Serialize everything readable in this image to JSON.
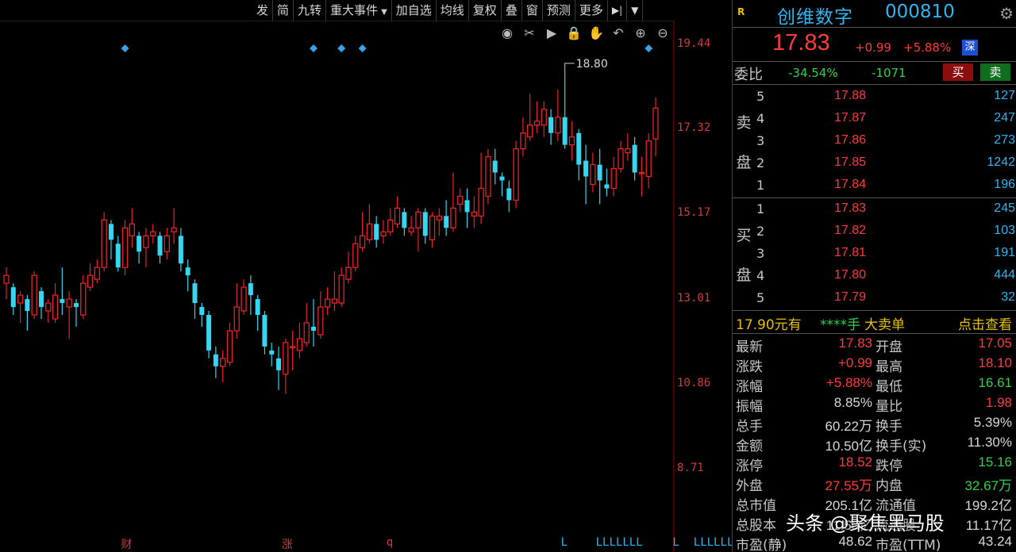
{
  "toolbar": {
    "items": [
      "发",
      "简",
      "九转",
      "重大事件",
      "加自选",
      "均线",
      "复权",
      "叠",
      "窗",
      "预测",
      "更多"
    ],
    "has_arrow": [
      false,
      false,
      false,
      true,
      false,
      false,
      false,
      false,
      false,
      false,
      false
    ]
  },
  "chart_tools": [
    "eye-icon",
    "scissors-icon",
    "play-icon",
    "lock-icon",
    "hand-icon",
    "undo-icon",
    "zoom-in-icon",
    "zoom-out-icon"
  ],
  "chart_data": {
    "type": "candlestick",
    "y_ticks": [
      "19.44",
      "17.32",
      "15.17",
      "13.01",
      "10.86",
      "8.71"
    ],
    "ylim": [
      8.71,
      19.44
    ],
    "peak_annotation": "18.80",
    "candles": [
      {
        "o": 13.4,
        "c": 13.6,
        "h": 13.8,
        "l": 13.0
      },
      {
        "o": 13.3,
        "c": 12.8,
        "h": 13.4,
        "l": 12.6
      },
      {
        "o": 12.9,
        "c": 13.1,
        "h": 13.2,
        "l": 12.4
      },
      {
        "o": 13.0,
        "c": 12.7,
        "h": 13.1,
        "l": 12.2
      },
      {
        "o": 12.6,
        "c": 13.6,
        "h": 13.7,
        "l": 12.5
      },
      {
        "o": 13.2,
        "c": 12.8,
        "h": 13.3,
        "l": 12.5
      },
      {
        "o": 12.7,
        "c": 12.9,
        "h": 13.0,
        "l": 12.4
      },
      {
        "o": 12.5,
        "c": 13.1,
        "h": 13.4,
        "l": 12.4
      },
      {
        "o": 13.0,
        "c": 12.9,
        "h": 13.8,
        "l": 12.6
      },
      {
        "o": 12.8,
        "c": 13.0,
        "h": 13.2,
        "l": 12.0
      },
      {
        "o": 12.9,
        "c": 12.8,
        "h": 13.0,
        "l": 12.3
      },
      {
        "o": 12.6,
        "c": 13.4,
        "h": 13.6,
        "l": 12.5
      },
      {
        "o": 13.3,
        "c": 13.6,
        "h": 13.9,
        "l": 13.2
      },
      {
        "o": 13.5,
        "c": 13.8,
        "h": 14.0,
        "l": 13.4
      },
      {
        "o": 13.8,
        "c": 15.0,
        "h": 15.2,
        "l": 13.7
      },
      {
        "o": 14.9,
        "c": 14.5,
        "h": 15.0,
        "l": 14.0
      },
      {
        "o": 14.4,
        "c": 13.8,
        "h": 14.6,
        "l": 13.7
      },
      {
        "o": 13.8,
        "c": 14.8,
        "h": 15.0,
        "l": 13.6
      },
      {
        "o": 14.6,
        "c": 14.9,
        "h": 15.3,
        "l": 14.3
      },
      {
        "o": 14.6,
        "c": 14.2,
        "h": 14.7,
        "l": 13.9
      },
      {
        "o": 14.3,
        "c": 14.6,
        "h": 14.8,
        "l": 13.8
      },
      {
        "o": 14.6,
        "c": 14.7,
        "h": 14.9,
        "l": 14.4
      },
      {
        "o": 14.6,
        "c": 14.1,
        "h": 14.7,
        "l": 13.9
      },
      {
        "o": 14.2,
        "c": 14.6,
        "h": 14.8,
        "l": 14.0
      },
      {
        "o": 14.7,
        "c": 14.8,
        "h": 15.3,
        "l": 14.4
      },
      {
        "o": 14.6,
        "c": 13.9,
        "h": 14.8,
        "l": 13.7
      },
      {
        "o": 13.8,
        "c": 13.6,
        "h": 14.0,
        "l": 13.2
      },
      {
        "o": 13.4,
        "c": 12.9,
        "h": 13.5,
        "l": 12.5
      },
      {
        "o": 12.8,
        "c": 12.6,
        "h": 12.9,
        "l": 12.3
      },
      {
        "o": 12.6,
        "c": 11.7,
        "h": 12.7,
        "l": 11.5
      },
      {
        "o": 11.6,
        "c": 11.3,
        "h": 11.8,
        "l": 11.0
      },
      {
        "o": 11.3,
        "c": 11.5,
        "h": 11.7,
        "l": 10.9
      },
      {
        "o": 11.4,
        "c": 12.2,
        "h": 12.4,
        "l": 11.3
      },
      {
        "o": 12.2,
        "c": 12.8,
        "h": 13.4,
        "l": 12.0
      },
      {
        "o": 12.7,
        "c": 13.3,
        "h": 13.5,
        "l": 12.6
      },
      {
        "o": 13.4,
        "c": 13.1,
        "h": 13.6,
        "l": 12.6
      },
      {
        "o": 13.0,
        "c": 12.6,
        "h": 13.1,
        "l": 12.2
      },
      {
        "o": 12.6,
        "c": 11.8,
        "h": 12.7,
        "l": 11.6
      },
      {
        "o": 11.7,
        "c": 11.6,
        "h": 11.9,
        "l": 11.3
      },
      {
        "o": 11.5,
        "c": 11.2,
        "h": 11.8,
        "l": 10.7
      },
      {
        "o": 11.1,
        "c": 11.9,
        "h": 12.0,
        "l": 10.6
      },
      {
        "o": 11.8,
        "c": 11.8,
        "h": 12.2,
        "l": 11.2
      },
      {
        "o": 11.7,
        "c": 12.0,
        "h": 12.4,
        "l": 11.5
      },
      {
        "o": 11.9,
        "c": 12.4,
        "h": 12.9,
        "l": 11.8
      },
      {
        "o": 12.3,
        "c": 12.2,
        "h": 13.0,
        "l": 11.8
      },
      {
        "o": 12.1,
        "c": 12.8,
        "h": 13.2,
        "l": 12.0
      },
      {
        "o": 12.8,
        "c": 13.0,
        "h": 13.3,
        "l": 12.6
      },
      {
        "o": 12.9,
        "c": 13.0,
        "h": 13.7,
        "l": 12.7
      },
      {
        "o": 12.9,
        "c": 13.6,
        "h": 13.8,
        "l": 12.8
      },
      {
        "o": 13.5,
        "c": 13.8,
        "h": 14.2,
        "l": 13.4
      },
      {
        "o": 13.8,
        "c": 14.4,
        "h": 14.6,
        "l": 13.7
      },
      {
        "o": 14.3,
        "c": 14.6,
        "h": 15.2,
        "l": 14.2
      },
      {
        "o": 14.5,
        "c": 14.9,
        "h": 15.4,
        "l": 14.4
      },
      {
        "o": 14.9,
        "c": 14.5,
        "h": 15.1,
        "l": 14.3
      },
      {
        "o": 14.6,
        "c": 14.7,
        "h": 15.0,
        "l": 14.4
      },
      {
        "o": 14.7,
        "c": 15.0,
        "h": 15.3,
        "l": 14.6
      },
      {
        "o": 14.9,
        "c": 15.3,
        "h": 15.6,
        "l": 14.8
      },
      {
        "o": 15.2,
        "c": 14.8,
        "h": 15.3,
        "l": 14.6
      },
      {
        "o": 14.7,
        "c": 14.8,
        "h": 15.1,
        "l": 14.6
      },
      {
        "o": 14.8,
        "c": 15.2,
        "h": 15.3,
        "l": 14.2
      },
      {
        "o": 15.2,
        "c": 14.6,
        "h": 15.3,
        "l": 14.4
      },
      {
        "o": 14.5,
        "c": 15.1,
        "h": 15.2,
        "l": 14.3
      },
      {
        "o": 15.0,
        "c": 15.1,
        "h": 15.3,
        "l": 14.6
      },
      {
        "o": 15.1,
        "c": 14.8,
        "h": 15.5,
        "l": 14.6
      },
      {
        "o": 14.8,
        "c": 15.3,
        "h": 16.2,
        "l": 14.7
      },
      {
        "o": 15.4,
        "c": 15.6,
        "h": 15.8,
        "l": 15.2
      },
      {
        "o": 15.5,
        "c": 15.2,
        "h": 15.8,
        "l": 14.8
      },
      {
        "o": 15.1,
        "c": 15.2,
        "h": 15.6,
        "l": 14.8
      },
      {
        "o": 15.1,
        "c": 15.8,
        "h": 16.7,
        "l": 14.9
      },
      {
        "o": 15.6,
        "c": 16.6,
        "h": 16.8,
        "l": 15.4
      },
      {
        "o": 16.5,
        "c": 16.2,
        "h": 16.8,
        "l": 15.9
      },
      {
        "o": 16.1,
        "c": 16.0,
        "h": 16.2,
        "l": 15.6
      },
      {
        "o": 15.8,
        "c": 15.5,
        "h": 16.0,
        "l": 15.2
      },
      {
        "o": 15.5,
        "c": 16.8,
        "h": 17.0,
        "l": 15.3
      },
      {
        "o": 16.8,
        "c": 17.2,
        "h": 17.6,
        "l": 16.6
      },
      {
        "o": 17.1,
        "c": 17.4,
        "h": 18.2,
        "l": 17.0
      },
      {
        "o": 17.4,
        "c": 17.5,
        "h": 18.0,
        "l": 17.2
      },
      {
        "o": 17.4,
        "c": 17.8,
        "h": 18.0,
        "l": 17.1
      },
      {
        "o": 17.6,
        "c": 17.2,
        "h": 17.8,
        "l": 16.9
      },
      {
        "o": 17.2,
        "c": 17.6,
        "h": 18.3,
        "l": 17.0
      },
      {
        "o": 17.6,
        "c": 16.9,
        "h": 18.8,
        "l": 16.8
      },
      {
        "o": 16.9,
        "c": 17.1,
        "h": 17.5,
        "l": 16.5
      },
      {
        "o": 17.2,
        "c": 16.4,
        "h": 17.3,
        "l": 16.0
      },
      {
        "o": 16.5,
        "c": 16.1,
        "h": 16.9,
        "l": 15.4
      },
      {
        "o": 15.9,
        "c": 16.4,
        "h": 16.7,
        "l": 15.7
      },
      {
        "o": 16.4,
        "c": 16.0,
        "h": 16.8,
        "l": 15.4
      },
      {
        "o": 15.9,
        "c": 15.8,
        "h": 16.3,
        "l": 15.6
      },
      {
        "o": 15.8,
        "c": 16.3,
        "h": 16.6,
        "l": 15.6
      },
      {
        "o": 16.3,
        "c": 16.8,
        "h": 17.0,
        "l": 16.2
      },
      {
        "o": 16.7,
        "c": 16.8,
        "h": 17.2,
        "l": 16.5
      },
      {
        "o": 16.9,
        "c": 16.2,
        "h": 17.1,
        "l": 16.0
      },
      {
        "o": 16.2,
        "c": 16.2,
        "h": 16.6,
        "l": 15.6
      },
      {
        "o": 16.1,
        "c": 17.0,
        "h": 17.2,
        "l": 15.8
      },
      {
        "o": 17.05,
        "c": 17.83,
        "h": 18.1,
        "l": 16.61
      }
    ],
    "diamond_markers_at_candle": [
      17,
      44,
      48,
      51,
      92
    ],
    "event_marks": [
      {
        "text": "财",
        "at": 17,
        "color": "#d23c3c"
      },
      {
        "text": "涨",
        "at": 40,
        "color": "#d23c3c"
      },
      {
        "text": "q",
        "at": 55,
        "color": "#d23c3c"
      },
      {
        "text": "L",
        "at": 80,
        "color": "#2fb5f0"
      },
      {
        "text": "LLLLLLL",
        "at": 85,
        "color": "#2fb5f0"
      },
      {
        "text": "L",
        "at": 96,
        "color": "#2fb5f0"
      },
      {
        "text": "LLLLLLL",
        "at": 99,
        "color": "#2fb5f0"
      }
    ]
  },
  "colors": {
    "up": "#e8222a",
    "down": "#35d6f0",
    "marker": "#3aa3e8"
  },
  "info": {
    "badge": "R",
    "name": "创维数字",
    "code": "000810",
    "price": "17.83",
    "change": "+0.99",
    "change_pct": "+5.88%",
    "exchange_badge": "深",
    "ratio_label": "委比",
    "ratio_pct": "-34.54%",
    "ratio_diff": "-1071",
    "buy_label": "买",
    "sell_label": "卖"
  },
  "sell_book": {
    "side_chars": [
      "卖",
      "盘"
    ],
    "rows": [
      {
        "level": "5",
        "price": "17.88",
        "vol": "127"
      },
      {
        "level": "4",
        "price": "17.87",
        "vol": "247"
      },
      {
        "level": "3",
        "price": "17.86",
        "vol": "273"
      },
      {
        "level": "2",
        "price": "17.85",
        "vol": "1242"
      },
      {
        "level": "1",
        "price": "17.84",
        "vol": "196"
      }
    ]
  },
  "buy_book": {
    "side_chars": [
      "买",
      "盘"
    ],
    "rows": [
      {
        "level": "1",
        "price": "17.83",
        "vol": "245"
      },
      {
        "level": "2",
        "price": "17.82",
        "vol": "103"
      },
      {
        "level": "3",
        "price": "17.81",
        "vol": "191"
      },
      {
        "level": "4",
        "price": "17.80",
        "vol": "444"
      },
      {
        "level": "5",
        "price": "17.79",
        "vol": "32"
      }
    ]
  },
  "big_order": {
    "price_text": "17.90元有",
    "stars": "****手",
    "text": "大卖单",
    "link": "点击查看"
  },
  "quote": [
    {
      "l1": "最新",
      "v1": "17.83",
      "c1": "red",
      "l2": "开盘",
      "v2": "17.05",
      "c2": "red"
    },
    {
      "l1": "涨跌",
      "v1": "+0.99",
      "c1": "red",
      "l2": "最高",
      "v2": "18.10",
      "c2": "red"
    },
    {
      "l1": "涨幅",
      "v1": "+5.88%",
      "c1": "red",
      "l2": "最低",
      "v2": "16.61",
      "c2": "green"
    },
    {
      "l1": "振幅",
      "v1": "8.85%",
      "c1": "white",
      "l2": "量比",
      "v2": "1.98",
      "c2": "red"
    },
    {
      "l1": "总手",
      "v1": "60.22万",
      "c1": "white",
      "l2": "换手",
      "v2": "5.39%",
      "c2": "white"
    },
    {
      "l1": "金额",
      "v1": "10.50亿",
      "c1": "white",
      "l2": "换手(实)",
      "v2": "11.30%",
      "c2": "white"
    },
    {
      "l1": "涨停",
      "v1": "18.52",
      "c1": "red",
      "l2": "跌停",
      "v2": "15.16",
      "c2": "green"
    },
    {
      "l1": "外盘",
      "v1": "27.55万",
      "c1": "red",
      "l2": "内盘",
      "v2": "32.67万",
      "c2": "green"
    },
    {
      "l1": "总市值",
      "v1": "205.1亿",
      "c1": "white",
      "l2": "流通值",
      "v2": "199.2亿",
      "c2": "white"
    },
    {
      "l1": "总股本",
      "v1": "11.50亿",
      "c1": "white",
      "l2": "流通股",
      "v2": "11.17亿",
      "c2": "white"
    },
    {
      "l1": "市盈(静)",
      "v1": "48.62",
      "c1": "white",
      "l2": "市盈(TTM)",
      "v2": "43.24",
      "c2": "white"
    }
  ],
  "watermark": "头条 @聚焦黑马股"
}
